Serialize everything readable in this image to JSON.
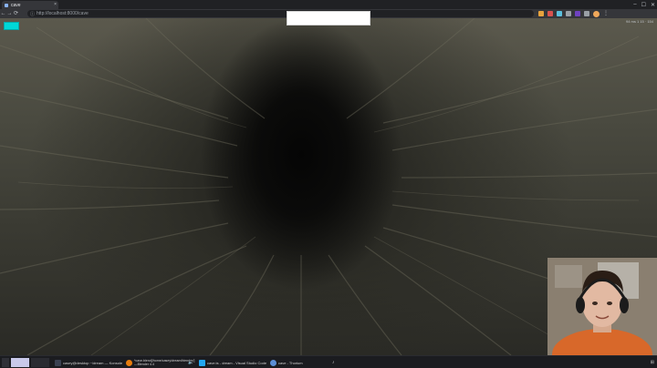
{
  "browser": {
    "tab_title": "cave",
    "tab_close": "×",
    "url": "http://localhost:8000/cave",
    "window_controls": [
      "–",
      "☐",
      "✕"
    ],
    "nav": [
      "←",
      "→",
      "⟳"
    ],
    "menu": "⋮"
  },
  "hud": {
    "stats": "94 ms  1 15 · 154"
  },
  "taskbar": {
    "items": [
      {
        "label": "casey@desktop ~/dream — Konsole"
      },
      {
        "label": "*cave.blend[/home/casey/dream/blender/]—Blender 4.4"
      },
      {
        "label": "cave.ts - dream - Visual Studio Code"
      },
      {
        "label": "cave - Thorium"
      }
    ],
    "tray": [
      "♪",
      "⊞"
    ]
  },
  "colors": {
    "accent_cyan": "#00d8d8",
    "chrome_dark": "#202124",
    "chrome_mid": "#35363a"
  }
}
